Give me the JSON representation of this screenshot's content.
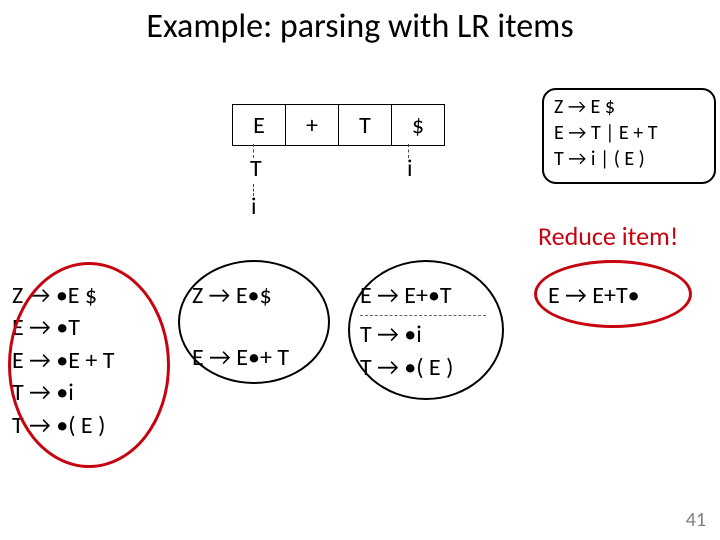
{
  "title": "Example: parsing with LR items",
  "tokens": [
    "E",
    "+",
    "T",
    "$"
  ],
  "sub_left_t": "T",
  "sub_left_i": "i",
  "sub_right_i": "i",
  "grammar": {
    "line1_pre": "Z",
    "line1_post": "E $",
    "line2_pre": "E",
    "line2_post": "T | E + T",
    "line3_pre": "T",
    "line3_post": "i | ( E )"
  },
  "reduce_label": "Reduce item!",
  "groups": {
    "g0": {
      "l1": "Z → •E $",
      "l2": "E → •T",
      "l3": "E → •E + T",
      "l4": "T → •i",
      "l5": "T → •( E )"
    },
    "g1": {
      "l1": "Z → E•$",
      "l2": "E → E•+ T"
    },
    "g2": {
      "l1": "E → E+•T",
      "l2": "T → •i",
      "l3": "T → •( E )"
    },
    "g3": {
      "l1": "E → E+T•"
    }
  },
  "page": "41"
}
